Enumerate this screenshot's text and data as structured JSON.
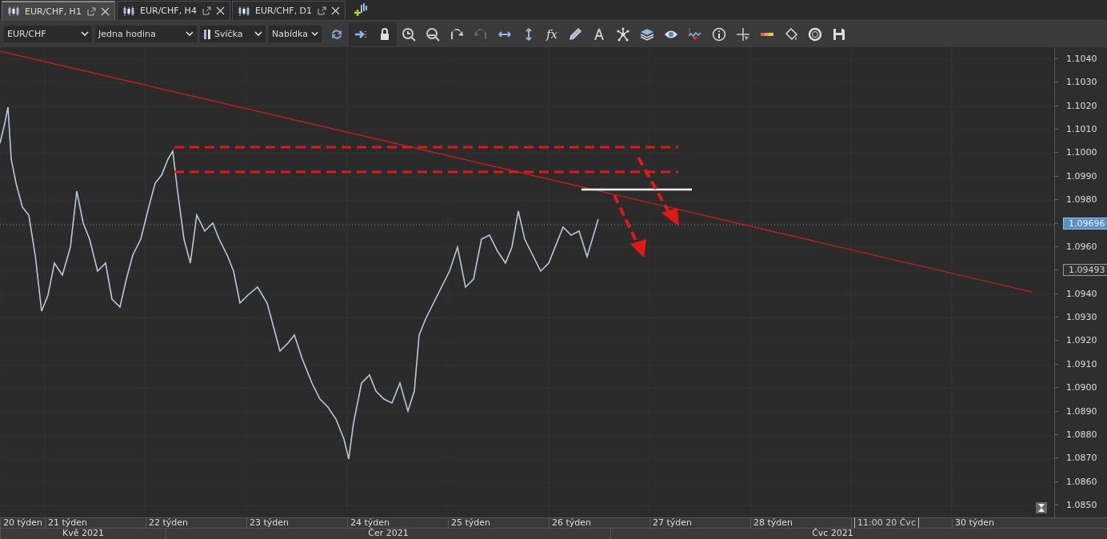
{
  "tabs": [
    {
      "label": "EUR/CHF, H1",
      "selected": true
    },
    {
      "label": "EUR/CHF, H4",
      "selected": false
    },
    {
      "label": "EUR/CHF, D1",
      "selected": false
    }
  ],
  "toolbar": {
    "dropdowns": [
      {
        "kind": "plain",
        "value": "EUR/CHF"
      },
      {
        "kind": "plain",
        "value": "Jedna hodina"
      },
      {
        "kind": "candle",
        "value": "Svíčka"
      },
      {
        "kind": "plain",
        "value": "Nabídka"
      }
    ],
    "function_button": "fx"
  },
  "chart": {
    "price_axis": [
      {
        "kind": "tick",
        "label": "1.1040"
      },
      {
        "kind": "tick",
        "label": "1.1030"
      },
      {
        "kind": "tick",
        "label": "1.1020"
      },
      {
        "kind": "tick",
        "label": "1.1010"
      },
      {
        "kind": "tick",
        "label": "1.1000"
      },
      {
        "kind": "tick",
        "label": "1.0990"
      },
      {
        "kind": "tick",
        "label": "1.0980"
      },
      {
        "kind": "last",
        "label": "1.09696"
      },
      {
        "kind": "tick",
        "label": "1.0960"
      },
      {
        "kind": "marker",
        "label": "1.09493"
      },
      {
        "kind": "tick",
        "label": "1.0940"
      },
      {
        "kind": "tick",
        "label": "1.0930"
      },
      {
        "kind": "tick",
        "label": "1.0920"
      },
      {
        "kind": "tick",
        "label": "1.0910"
      },
      {
        "kind": "tick",
        "label": "1.0900"
      },
      {
        "kind": "tick",
        "label": "1.0890"
      },
      {
        "kind": "tick",
        "label": "1.0880"
      },
      {
        "kind": "tick",
        "label": "1.0870"
      },
      {
        "kind": "tick",
        "label": "1.0860"
      },
      {
        "kind": "tick",
        "label": "1.0850"
      }
    ],
    "weeks": [
      {
        "kind": "week",
        "label": "20 týden"
      },
      {
        "kind": "week",
        "label": "21 týden"
      },
      {
        "kind": "week",
        "label": "22 týden"
      },
      {
        "kind": "week",
        "label": "23 týden"
      },
      {
        "kind": "week",
        "label": "24 týden"
      },
      {
        "kind": "week",
        "label": "25 týden"
      },
      {
        "kind": "week",
        "label": "26 týden"
      },
      {
        "kind": "week",
        "label": "27 týden"
      },
      {
        "kind": "week",
        "label": "28 týden"
      },
      {
        "kind": "cursor",
        "label": "11:00 20 Čvc"
      },
      {
        "kind": "week",
        "label": "30 týden"
      }
    ],
    "months": [
      "Kvě 2021",
      "Čer 2021",
      "Čvc 2021"
    ]
  }
}
